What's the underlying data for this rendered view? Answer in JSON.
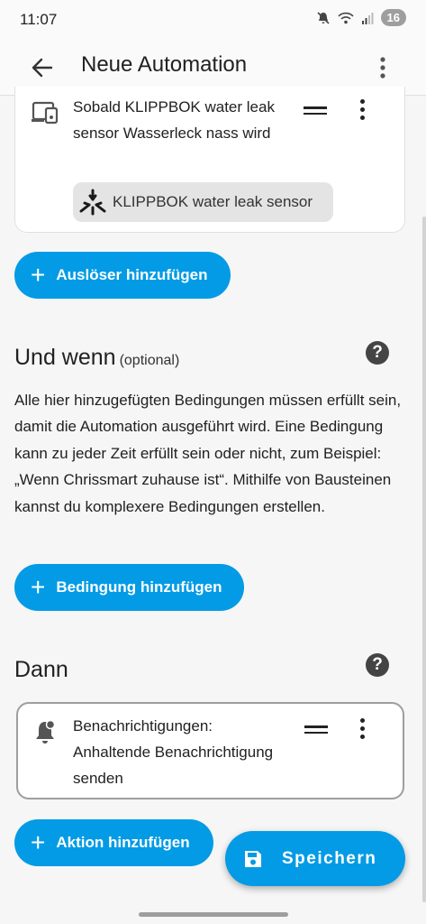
{
  "status_bar": {
    "time": "11:07",
    "battery": "16",
    "icons": [
      "mute-icon",
      "wifi-icon",
      "signal-icon"
    ]
  },
  "app_bar": {
    "title": "Neue Automation"
  },
  "trigger": {
    "text": "Sobald KLIPPBOK water leak sensor Wasserleck nass wird",
    "chip_label": "KLIPPBOK water leak sensor"
  },
  "buttons": {
    "add_trigger": "Auslöser hinzufügen",
    "add_condition": "Bedingung hinzufügen",
    "add_action": "Aktion hinzufügen",
    "save": "Speichern",
    "plus": "+"
  },
  "conditions": {
    "title": "Und wenn",
    "optional": "(optional)",
    "description": "Alle hier hinzugefügten Bedingungen müssen erfüllt sein, damit die Automation ausgeführt wird. Eine Bedingung kann zu jeder Zeit erfüllt sein oder nicht, zum Beispiel: „Wenn Chrissmart zuhause ist“. Mithilfe von Bausteinen kannst du komplexere Bedingungen erstellen."
  },
  "actions": {
    "title": "Dann",
    "item_text": "Benachrichtigungen: Anhaltende Benachrichtigung senden"
  },
  "help": "?",
  "colors": {
    "accent": "#039be5",
    "background": "#f6f6f6",
    "card": "#ffffff"
  }
}
